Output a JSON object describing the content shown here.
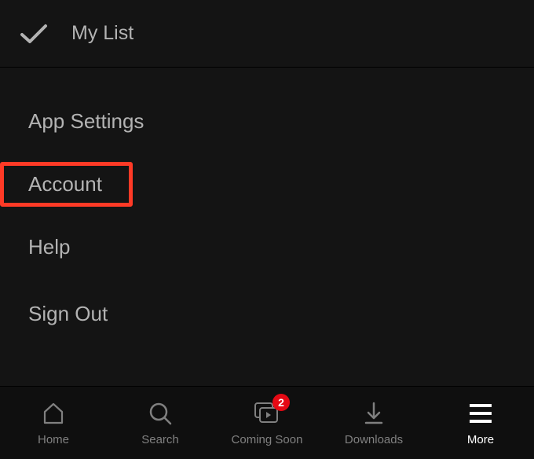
{
  "top": {
    "mylist_label": "My List"
  },
  "menu": {
    "items": [
      {
        "label": "App Settings",
        "highlighted": false
      },
      {
        "label": "Account",
        "highlighted": true
      },
      {
        "label": "Help",
        "highlighted": false
      },
      {
        "label": "Sign Out",
        "highlighted": false
      }
    ]
  },
  "tabs": {
    "home": {
      "label": "Home"
    },
    "search": {
      "label": "Search"
    },
    "coming_soon": {
      "label": "Coming Soon",
      "badge": "2"
    },
    "downloads": {
      "label": "Downloads"
    },
    "more": {
      "label": "More",
      "active": true
    }
  }
}
